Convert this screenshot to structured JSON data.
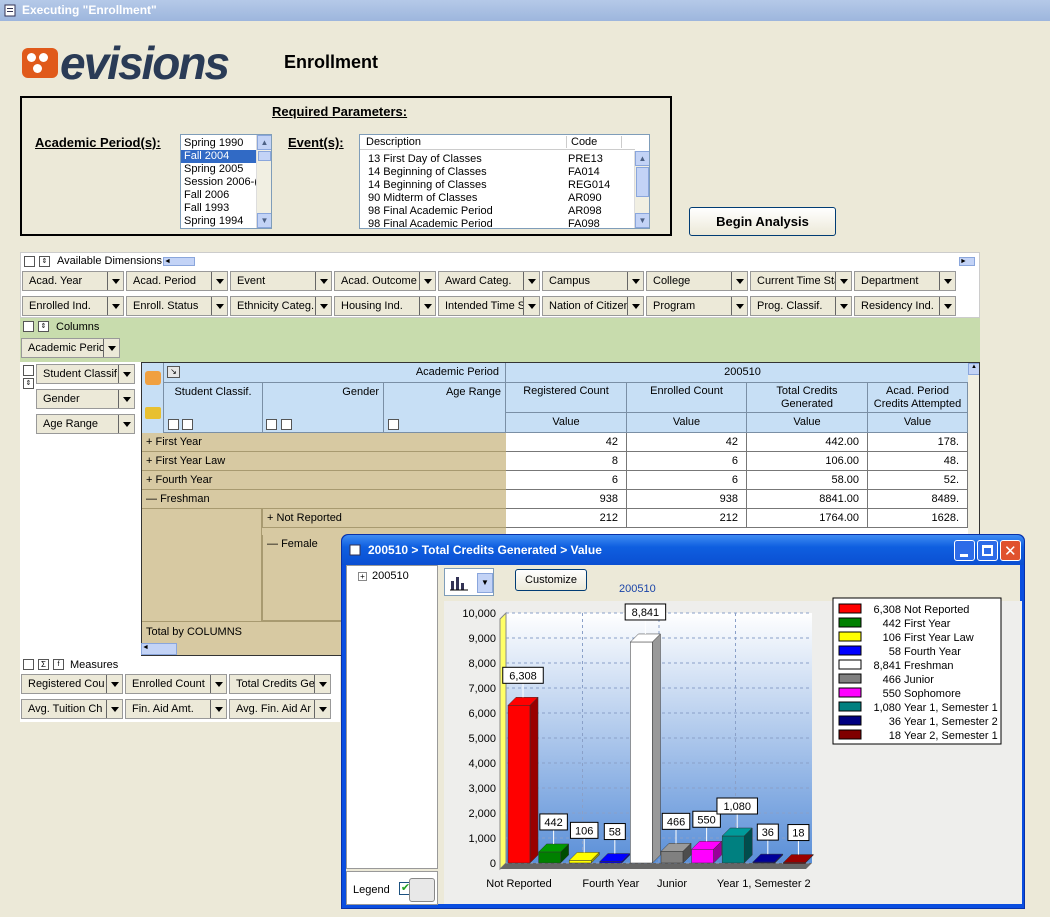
{
  "window": {
    "title": "Executing \"Enrollment\""
  },
  "app": {
    "logo_text": "evisions",
    "report_title": "Enrollment"
  },
  "params": {
    "title": "Required Parameters:",
    "academic_period_label": "Academic Period(s):",
    "event_label": "Event(s):",
    "academic_periods": [
      "Spring 1990",
      "Fall 2004",
      "Spring 2005",
      "Session 2006-(",
      "Fall 2006",
      "Fall 1993",
      "Spring 1994"
    ],
    "selected_period": "Fall 2004",
    "event_headers": [
      "Description",
      "Code"
    ],
    "events": [
      [
        "13 First Day of Classes",
        "PRE13"
      ],
      [
        "14 Beginning of Classes",
        "FA014"
      ],
      [
        "14 Beginning of Classes",
        "REG014"
      ],
      [
        "90 Midterm of Classes",
        "AR090"
      ],
      [
        "98 Final Academic Period",
        "AR098"
      ],
      [
        "98 Final Academic Period",
        "FA098"
      ]
    ],
    "begin_button": "Begin Analysis"
  },
  "dimensions": {
    "label": "Available Dimensions",
    "row1": [
      "Acad. Year",
      "Acad. Period",
      "Event",
      "Acad. Outcome",
      "Award Categ.",
      "Campus",
      "College",
      "Current Time Sta",
      "Department"
    ],
    "row2": [
      "Enrolled Ind.",
      "Enroll. Status",
      "Ethnicity Categ.",
      "Housing Ind.",
      "Intended Time St",
      "Nation of Citizen",
      "Program",
      "Prog. Classif.",
      "Residency Ind."
    ]
  },
  "columns": {
    "label": "Columns",
    "items": [
      "Academic Period"
    ]
  },
  "row_dims": [
    "Student Classif.",
    "Gender",
    "Age Range"
  ],
  "grid": {
    "academic_period_label": "Academic Period",
    "period_value": "200510",
    "row_headers": [
      "Student Classif.",
      "Gender",
      "Age Range"
    ],
    "measure_headers": [
      "Registered Count",
      "Enrolled Count",
      "Total Credits Generated",
      "Acad. Period Credits Attempted"
    ],
    "value_label": "Value",
    "rows": [
      {
        "label": "First Year",
        "sign": "+",
        "values": [
          "42",
          "42",
          "442.00",
          "178."
        ]
      },
      {
        "label": "First Year Law",
        "sign": "+",
        "values": [
          "8",
          "6",
          "106.00",
          "48."
        ]
      },
      {
        "label": "Fourth Year",
        "sign": "+",
        "values": [
          "6",
          "6",
          "58.00",
          "52."
        ]
      },
      {
        "label": "Freshman",
        "sign": "—",
        "values": [
          "938",
          "938",
          "8841.00",
          "8489."
        ]
      },
      {
        "label": "Not Reported",
        "sign": "+",
        "values": [
          "212",
          "212",
          "1764.00",
          "1628."
        ]
      }
    ],
    "female_label": "Female",
    "female_sign": "—",
    "total_label": "Total by COLUMNS"
  },
  "measures": {
    "label": "Measures",
    "row1": [
      "Registered Cou",
      "Enrolled Count",
      "Total Credits Ge"
    ],
    "row2": [
      "Avg. Tuition Ch",
      "Fin. Aid Amt.",
      "Avg. Fin. Aid Ar"
    ]
  },
  "chart_window": {
    "title": "200510 > Total Credits Generated > Value",
    "tree_item": "200510",
    "customize_button": "Customize",
    "legend_label": "Legend"
  },
  "chart_data": {
    "type": "bar",
    "title": "200510",
    "categories": [
      "Not Reported",
      "First Year",
      "First Year Law",
      "Fourth Year",
      "Freshman",
      "Junior",
      "Sophomore",
      "Year 1, Semester 1",
      "Year 1, Semester 2",
      "Year 2, Semester 1"
    ],
    "values": [
      6308,
      442,
      106,
      58,
      8841,
      466,
      550,
      1080,
      36,
      18
    ],
    "value_labels": [
      "6,308",
      "442",
      "106",
      "58",
      "8,841",
      "466",
      "550",
      "1,080",
      "36",
      "18"
    ],
    "colors": [
      "#ff0000",
      "#008000",
      "#ffff00",
      "#0000ff",
      "#ffffff",
      "#808080",
      "#ff00ff",
      "#008080",
      "#000080",
      "#800000"
    ],
    "x_tick_labels": [
      "Not Reported",
      "Fourth Year",
      "Junior",
      "Year 1, Semester 2"
    ],
    "y_ticks": [
      "0",
      "1,000",
      "2,000",
      "3,000",
      "4,000",
      "5,000",
      "6,000",
      "7,000",
      "8,000",
      "9,000",
      "10,000"
    ],
    "ylim": [
      0,
      10000
    ],
    "grid": true,
    "legend_position": "right"
  }
}
